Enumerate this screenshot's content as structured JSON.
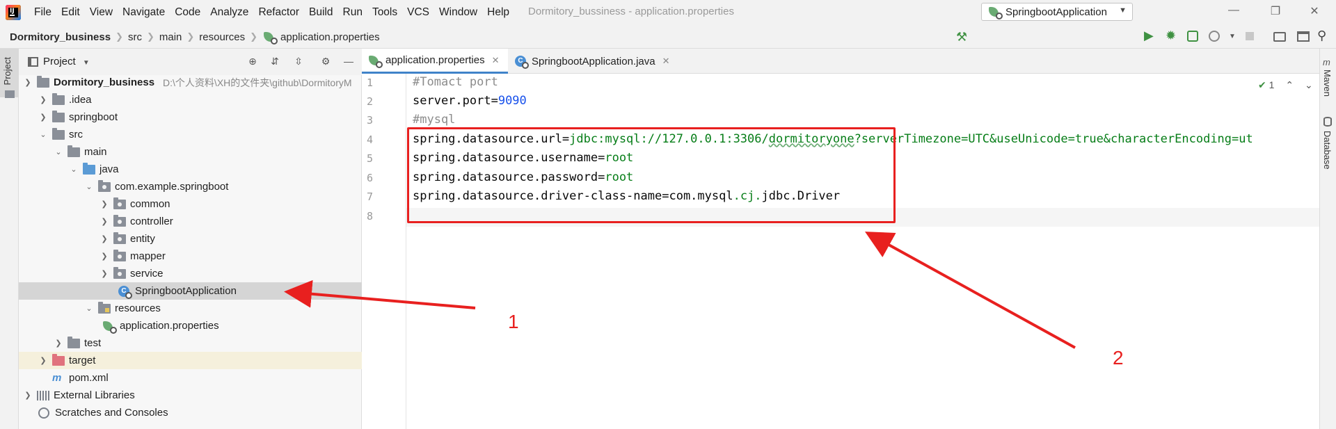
{
  "menubar": {
    "items": [
      "File",
      "Edit",
      "View",
      "Navigate",
      "Code",
      "Analyze",
      "Refactor",
      "Build",
      "Run",
      "Tools",
      "VCS",
      "Window",
      "Help"
    ],
    "window_title": "Dormitory_bussiness - application.properties"
  },
  "breadcrumb": [
    "Dormitory_business",
    "src",
    "main",
    "resources",
    "application.properties"
  ],
  "run_config": "SpringbootApplication",
  "left_strip": {
    "project_label": "Project"
  },
  "project_panel": {
    "title": "Project",
    "root": {
      "name": "Dormitory_business",
      "path": "D:\\个人资料\\XH的文件夹\\github\\DormitoryM"
    },
    "tree": [
      {
        "label": ".idea"
      },
      {
        "label": "springboot"
      },
      {
        "label": "src"
      },
      {
        "label": "main"
      },
      {
        "label": "java"
      },
      {
        "label": "com.example.springboot"
      },
      {
        "label": "common"
      },
      {
        "label": "controller"
      },
      {
        "label": "entity"
      },
      {
        "label": "mapper"
      },
      {
        "label": "service"
      },
      {
        "label": "SpringbootApplication"
      },
      {
        "label": "resources"
      },
      {
        "label": "application.properties"
      },
      {
        "label": "test"
      },
      {
        "label": "target"
      },
      {
        "label": "pom.xml"
      },
      {
        "label": "External Libraries"
      },
      {
        "label": "Scratches and Consoles"
      }
    ]
  },
  "editor": {
    "tabs": [
      "application.properties",
      "SpringbootApplication.java"
    ],
    "line_numbers": [
      "1",
      "2",
      "3",
      "4",
      "5",
      "6",
      "7",
      "8"
    ],
    "lines": {
      "l1": "#Tomact port",
      "l2_key": "server.port=",
      "l2_val": "9090",
      "l3": "#mysql",
      "l4_key": "spring.datasource.url=",
      "l4_val_a": "jdbc:mysql://127.0.0.1:3306/",
      "l4_val_b": "dormitoryone",
      "l4_val_c": "?serverTimezone=UTC&useUnicode=true&characterEncoding=ut",
      "l5_key": "spring.datasource.username=",
      "l5_val": "root",
      "l6_key": "spring.datasource.password=",
      "l6_val": "root",
      "l7_key": "spring.datasource.driver-class-name=",
      "l7_a": "com.mysql",
      "l7_b": ".cj.",
      "l7_c": "jdbc.Driver"
    },
    "inspection_count": "1"
  },
  "right_strip": {
    "maven": "Maven",
    "database": "Database"
  },
  "annotations": {
    "label1": "1",
    "label2": "2"
  },
  "colors": {
    "annotation_red": "#e8201f",
    "accent_blue": "#4083c9",
    "value_green": "#067d17",
    "number_blue": "#1750eb"
  }
}
